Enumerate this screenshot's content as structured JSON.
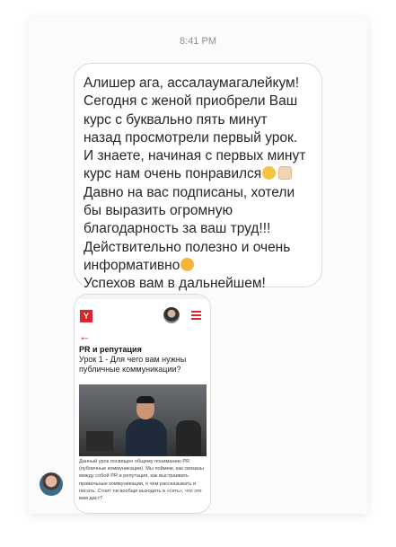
{
  "chat": {
    "timestamp": "8:41 PM",
    "message_lines": [
      "Алишер ага, ассалаумагалейкум!",
      "Сегодня с женой приобрели Ваш",
      "курс с  буквально пять минут",
      "назад просмотрели первый урок.",
      "И знаете,  начиная с первых минут",
      "курс нам очень понравился",
      "Давно на вас подписаны, хотели",
      "бы выразить огромную",
      "благодарность за ваш труд!!!",
      "Действительно полезно и очень",
      "информативно",
      "Успехов вам в дальнейшем!"
    ]
  },
  "screenshot": {
    "logo": "Y",
    "lesson_title": "PR и репутация",
    "lesson_subtitle": "Урок 1 - Для чего вам нужны публичные коммуникации?",
    "description": "Данный урок посвящен общему пониманию PR (публичные коммуникации). Мы поймем, как связаны между собой PR и репутация, как выстраивать правильные коммуникации, о чем рассказывать и писать. Стоит ли вообще выходить в «сеть», что это вам даст?"
  },
  "icons": {
    "back": "arrow-left-icon",
    "menu": "hamburger-menu-icon",
    "avatar": "user-avatar"
  },
  "colors": {
    "brand_red": "#d9252b",
    "bubble_border": "#dcdcdc",
    "timestamp": "#8e8e93"
  }
}
